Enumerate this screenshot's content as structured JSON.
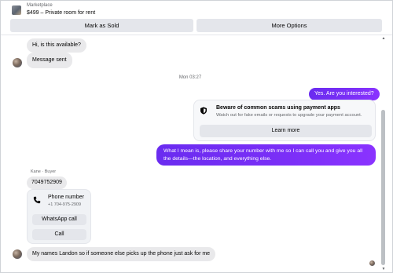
{
  "header": {
    "kicker": "Marketplace",
    "title": "$499 – Private room for rent",
    "mark_sold_label": "Mark as Sold",
    "more_options_label": "More Options"
  },
  "scrollbar": {
    "up_glyph": "▲",
    "down_glyph": "▼"
  },
  "messages": {
    "m1": "Hi, is this available?",
    "m2": "Message sent",
    "timestamp": "Mon 03:27",
    "m3": "Yes. Are you interested?",
    "m4_line1": "What I mean is, please share your number with me so I can call you and give you all",
    "m4_line2": "the details—the location, and everything else.",
    "sender_name": "Kane · Buyer",
    "m5": "7049752909",
    "m6": "My names Landon so if someone else picks up the phone just ask for me"
  },
  "warning_card": {
    "title": "Beware of common scams using payment apps",
    "body": "Watch out for fake emails or requests to upgrade your payment account.",
    "button_label": "Learn more",
    "icon": "shield-icon"
  },
  "phone_card": {
    "label": "Phone number",
    "number": "+1 704-975-2909",
    "whatsapp_label": "WhatsApp call",
    "call_label": "Call",
    "icon": "phone-icon"
  },
  "colors": {
    "outgoing_bubble": "#7b2ff7",
    "incoming_bubble": "#e9e9eb",
    "button_bg": "#e4e6eb"
  }
}
